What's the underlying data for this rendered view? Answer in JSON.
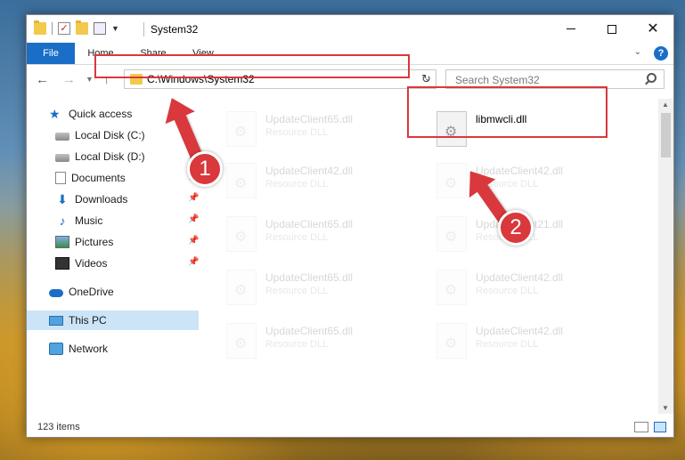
{
  "window": {
    "title": "System32"
  },
  "ribbon": {
    "tabs": [
      "File",
      "Home",
      "Share",
      "View"
    ],
    "expand_glyph": "⌄",
    "help_glyph": "?"
  },
  "address": {
    "path": "C:\\Windows\\System32",
    "dropdown_glyph": "⌄",
    "refresh_glyph": "↻"
  },
  "search": {
    "placeholder": "Search System32"
  },
  "sidebar": {
    "items": [
      {
        "label": "Quick access",
        "icon": "star-icon"
      },
      {
        "label": "Local Disk (C:)",
        "icon": "disk-icon"
      },
      {
        "label": "Local Disk (D:)",
        "icon": "disk-icon"
      },
      {
        "label": "Documents",
        "icon": "documents-icon"
      },
      {
        "label": "Downloads",
        "icon": "download-icon"
      },
      {
        "label": "Music",
        "icon": "music-icon"
      },
      {
        "label": "Pictures",
        "icon": "pictures-icon"
      },
      {
        "label": "Videos",
        "icon": "videos-icon"
      },
      {
        "label": "OneDrive",
        "icon": "cloud-icon"
      },
      {
        "label": "This PC",
        "icon": "computer-icon"
      },
      {
        "label": "Network",
        "icon": "network-icon"
      }
    ]
  },
  "files": [
    {
      "name": "UpdateClient65.dll",
      "type": "Resource DLL"
    },
    {
      "name": "libmwcli.dll",
      "type": ""
    },
    {
      "name": "UpdateClient42.dll",
      "type": "Resource DLL"
    },
    {
      "name": "UpdateClient42.dll",
      "type": "Resource DLL"
    },
    {
      "name": "UpdateClient65.dll",
      "type": "Resource DLL"
    },
    {
      "name": "UpdateClient21.dll",
      "type": "Resource DLL"
    },
    {
      "name": "UpdateClient65.dll",
      "type": "Resource DLL"
    },
    {
      "name": "UpdateClient42.dll",
      "type": "Resource DLL"
    },
    {
      "name": "UpdateClient65.dll",
      "type": "Resource DLL"
    },
    {
      "name": "UpdateClient42.dll",
      "type": "Resource DLL"
    }
  ],
  "status": {
    "count": "123 items"
  },
  "annotations": {
    "step1": "1",
    "step2": "2"
  },
  "colors": {
    "accent": "#1a6ec7",
    "highlight": "#d9383c",
    "selected": "#cce4f7"
  }
}
